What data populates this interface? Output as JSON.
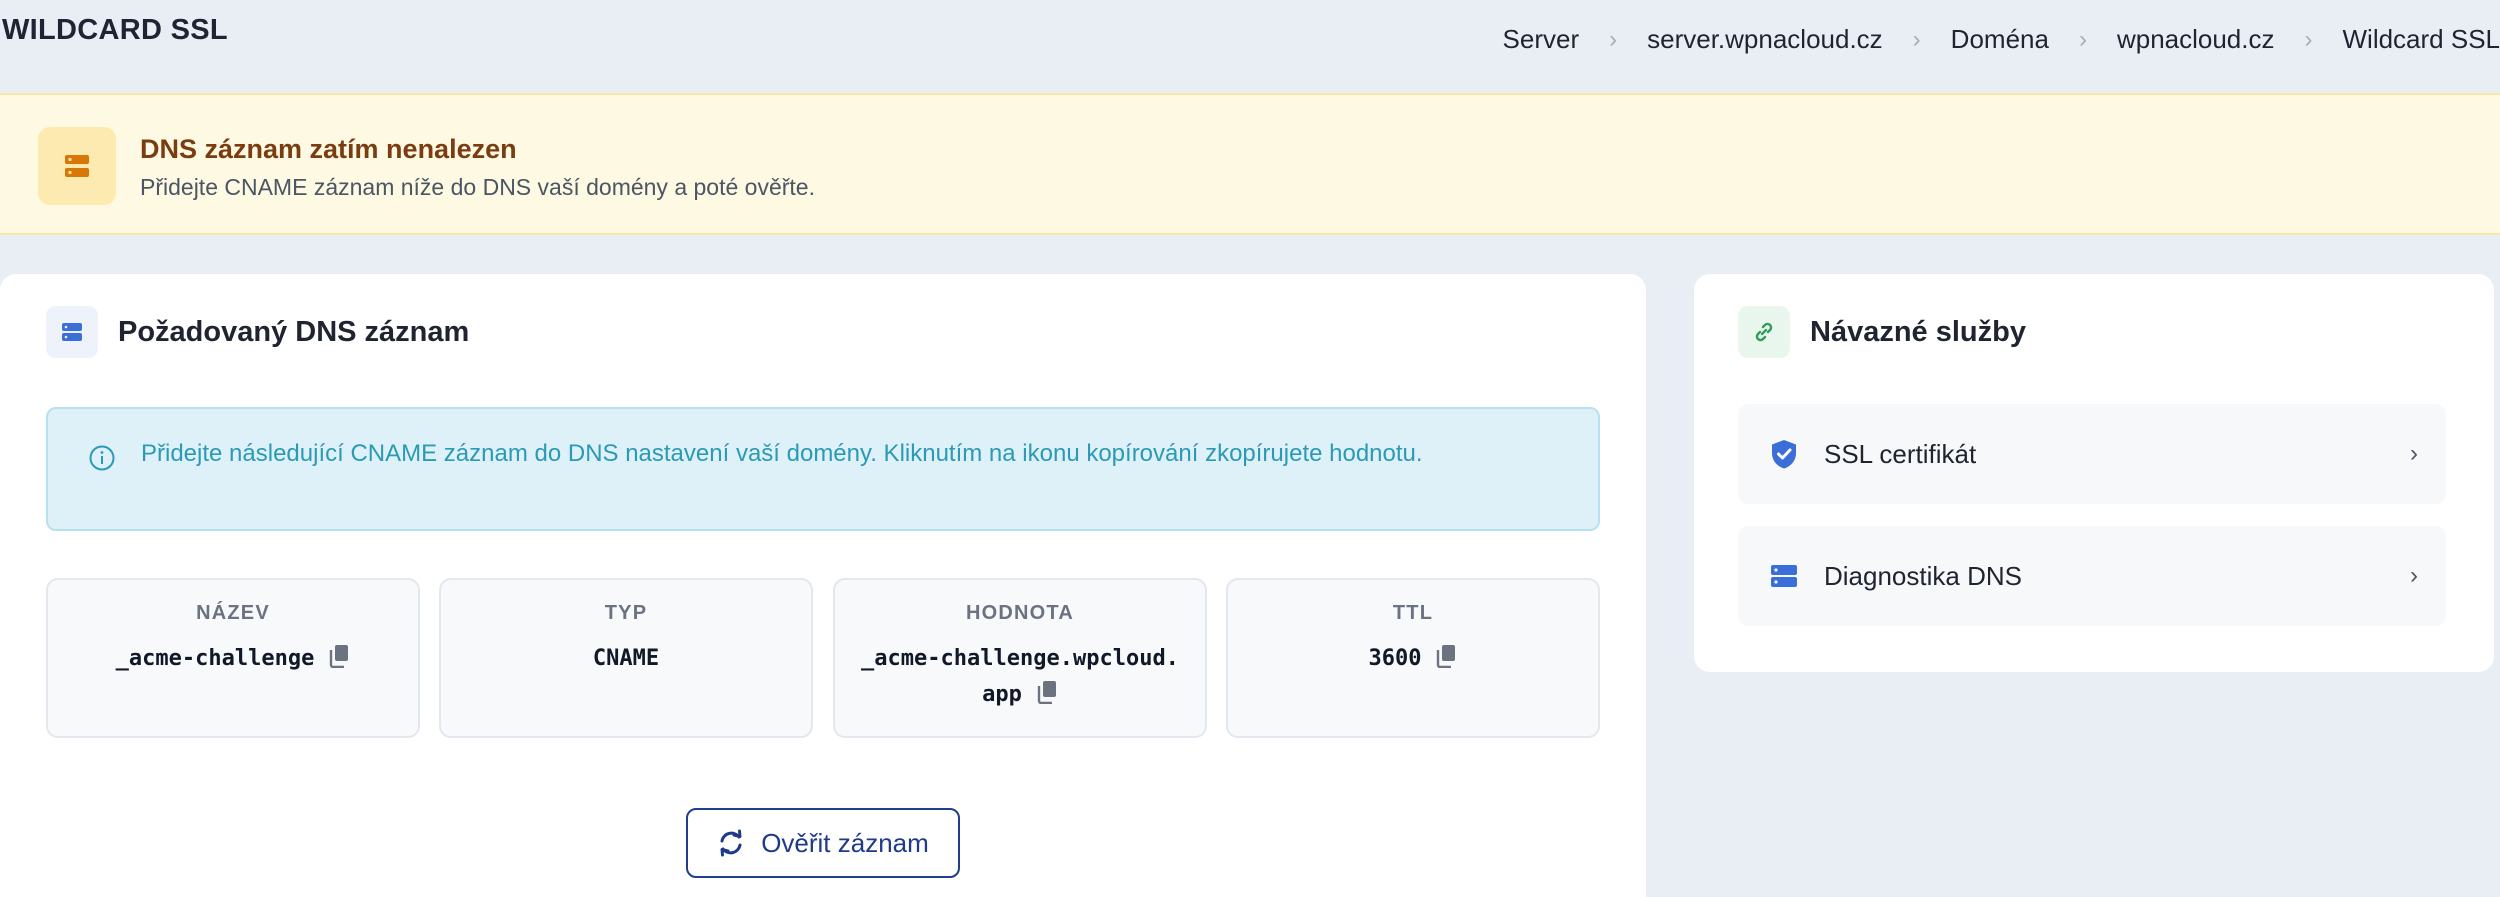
{
  "page": {
    "title": "WILDCARD SSL"
  },
  "breadcrumb": [
    {
      "label": "Server"
    },
    {
      "label": "server.wpnacloud.cz"
    },
    {
      "label": "Doména"
    },
    {
      "label": "wpnacloud.cz"
    },
    {
      "label": "Wildcard SSL"
    }
  ],
  "warning": {
    "title": "DNS záznam zatím nenalezen",
    "description": "Přidejte CNAME záznam níže do DNS vaší domény a poté ověřte."
  },
  "dns_card": {
    "title": "Požadovaný DNS záznam",
    "info": "Přidejte následující CNAME záznam do DNS nastavení vaší domény. Kliknutím na ikonu kopírování zkopírujete hodnotu.",
    "fields": [
      {
        "label": "NÁZEV",
        "value": "_acme-challenge",
        "copyable": true
      },
      {
        "label": "TYP",
        "value": "CNAME",
        "copyable": false
      },
      {
        "label": "HODNOTA",
        "value": "_acme-challenge.wpcloud.app",
        "copyable": true
      },
      {
        "label": "TTL",
        "value": "3600",
        "copyable": true
      }
    ],
    "verify_button": "Ověřit záznam"
  },
  "services_card": {
    "title": "Návazné služby",
    "items": [
      {
        "label": "SSL certifikát",
        "icon": "shield-check-icon"
      },
      {
        "label": "Diagnostika DNS",
        "icon": "server-icon"
      }
    ]
  },
  "colors": {
    "accent": "#1e3a8a",
    "warning_bg": "#fef9e3",
    "info_bg": "#dff1f8",
    "icon_blue": "#3b6fd8",
    "link_green": "#2e9d5b"
  }
}
